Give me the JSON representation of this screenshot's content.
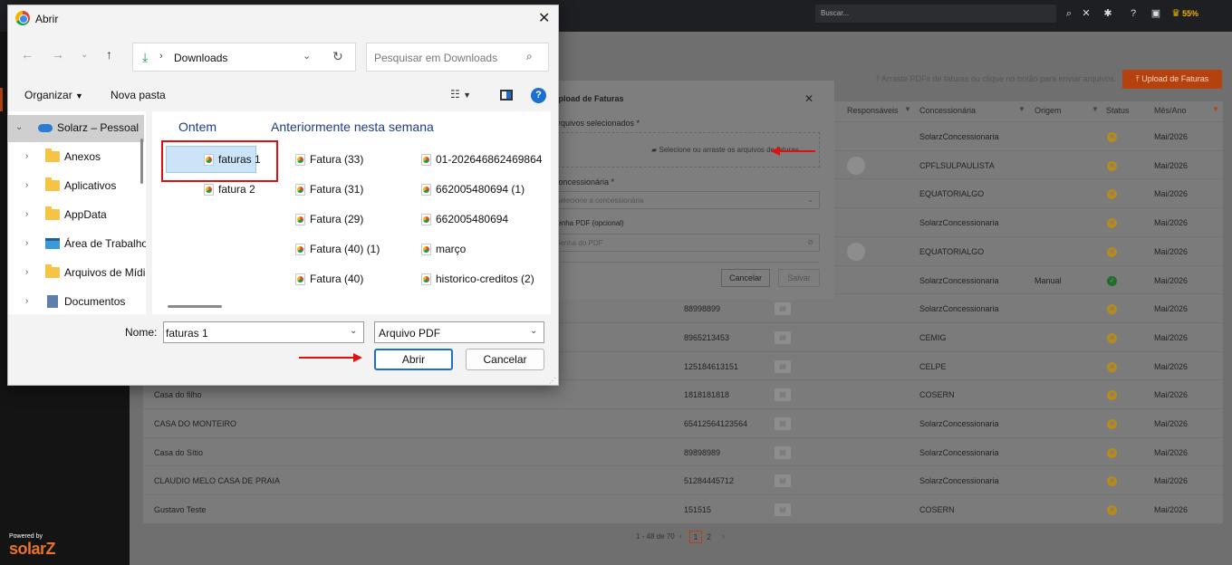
{
  "app": {
    "search_placeholder": "Buscar...",
    "battery": "55%",
    "powered_by": "Powered by",
    "brand": "solarZ",
    "hint": "Arraste PDFs de faturas ou clique no botão para enviar arquivos.",
    "upload_button": "Upload de Faturas",
    "accent_color": "#e9732a"
  },
  "table": {
    "headers": {
      "responsaveis": "Responsáveis",
      "concessionaria": "Concessionária",
      "origem": "Origem",
      "status": "Status",
      "mes_ano": "Mês/Ano"
    },
    "rows": [
      {
        "name": "",
        "number": "",
        "conc": "SolarzConcessionaria",
        "origem": "",
        "status": "x",
        "mes": "Mai/2026"
      },
      {
        "name": "",
        "number": "",
        "conc": "CPFLSULPAULISTA",
        "origem": "",
        "status": "x",
        "mes": "Mai/2026"
      },
      {
        "name": "",
        "number": "",
        "conc": "EQUATORIALGO",
        "origem": "",
        "status": "x",
        "mes": "Mai/2026"
      },
      {
        "name": "",
        "number": "",
        "conc": "SolarzConcessionaria",
        "origem": "",
        "status": "x",
        "mes": "Mai/2026"
      },
      {
        "name": "",
        "number": "",
        "conc": "EQUATORIALGO",
        "origem": "",
        "status": "x",
        "mes": "Mai/2026"
      },
      {
        "name": "",
        "number": "",
        "conc": "SolarzConcessionaria",
        "origem": "Manual",
        "status": "check",
        "mes": "Mai/2026"
      },
      {
        "name": "",
        "number": "88998899",
        "conc": "SolarzConcessionaria",
        "origem": "",
        "status": "x",
        "mes": "Mai/2026"
      },
      {
        "name": "",
        "number": "8965213453",
        "conc": "CEMIG",
        "origem": "",
        "status": "x",
        "mes": "Mai/2026"
      },
      {
        "name": "",
        "number": "125184613151",
        "conc": "CELPE",
        "origem": "",
        "status": "x",
        "mes": "Mai/2026"
      },
      {
        "name": "Casa do filho",
        "number": "1818181818",
        "conc": "COSERN",
        "origem": "",
        "status": "x",
        "mes": "Mai/2026"
      },
      {
        "name": "CASA DO MONTEIRO",
        "number": "65412564123564",
        "conc": "SolarzConcessionaria",
        "origem": "",
        "status": "x",
        "mes": "Mai/2026"
      },
      {
        "name": "Casa do Sítio",
        "number": "89898989",
        "conc": "SolarzConcessionaria",
        "origem": "",
        "status": "x",
        "mes": "Mai/2026"
      },
      {
        "name": "CLAUDIO MELO CASA DE PRAIA",
        "number": "51284445712",
        "conc": "SolarzConcessionaria",
        "origem": "",
        "status": "x",
        "mes": "Mai/2026"
      },
      {
        "name": "Gustavo Teste",
        "number": "151515",
        "conc": "COSERN",
        "origem": "",
        "status": "x",
        "mes": "Mai/2026"
      }
    ]
  },
  "pager": {
    "total": "1 - 48 de 70",
    "page1": "1",
    "page2": "2"
  },
  "upload_modal": {
    "title": "Upload de Faturas",
    "files_label": "Arquivos selecionados *",
    "drop_text": "Selecione ou arraste os arquivos de faturas",
    "conc_label": "Concessionária *",
    "conc_placeholder": "Selecione a concessionária",
    "pass_label": "Senha PDF (opcional)",
    "pass_placeholder": "Senha do PDF",
    "cancel": "Cancelar",
    "save": "Salvar"
  },
  "file_dialog": {
    "title": "Abrir",
    "path": "Downloads",
    "search_placeholder": "Pesquisar em Downloads",
    "organize": "Organizar",
    "new_folder": "Nova pasta",
    "tree": [
      {
        "label": "Solarz – Pessoal",
        "icon": "cloud",
        "selected": true
      },
      {
        "label": "Anexos",
        "icon": "folder"
      },
      {
        "label": "Aplicativos",
        "icon": "folder"
      },
      {
        "label": "AppData",
        "icon": "folder"
      },
      {
        "label": "Área de Trabalho",
        "icon": "desktop"
      },
      {
        "label": "Arquivos de Mídia",
        "icon": "folder"
      },
      {
        "label": "Documentos",
        "icon": "docs"
      }
    ],
    "groups": {
      "yesterday": "Ontem",
      "earlier": "Anteriormente nesta semana"
    },
    "files_yesterday": [
      "faturas 1",
      "fatura 2"
    ],
    "files_earlier_col1": [
      "Fatura (33)",
      "Fatura (31)",
      "Fatura (29)",
      "Fatura (40) (1)",
      "Fatura (40)"
    ],
    "files_earlier_col2": [
      "01-202646862469864",
      "662005480694 (1)",
      "662005480694",
      "março",
      "historico-creditos (2)"
    ],
    "name_label": "Nome:",
    "name_value": "faturas 1",
    "type_value": "Arquivo PDF",
    "open": "Abrir",
    "cancel": "Cancelar"
  }
}
